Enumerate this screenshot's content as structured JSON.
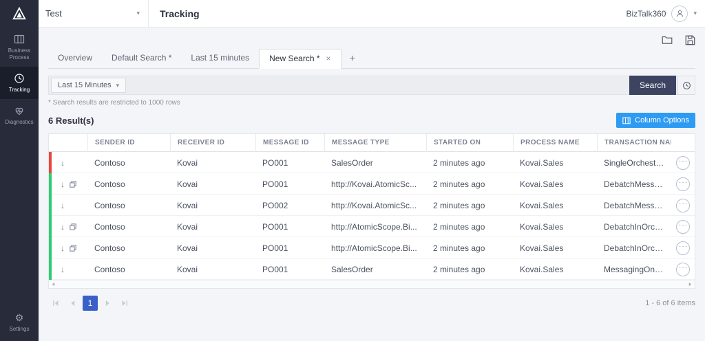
{
  "colors": {
    "sidebar_bg": "#272b3a",
    "accent_blue": "#2e9bf3",
    "search_button": "#3c4461",
    "pager_active": "#3a5fc8",
    "status_red": "#e9473d",
    "status_green": "#2dcc70"
  },
  "icons": {
    "caret": "▾",
    "download": "↓",
    "more": "···",
    "gear": "⚙"
  },
  "topbar": {
    "workspace": "Test",
    "title": "Tracking",
    "user_label": "BizTalk360"
  },
  "sidebar": {
    "items": [
      {
        "label": "Business Process"
      },
      {
        "label": "Tracking"
      },
      {
        "label": "Diagnostics"
      }
    ],
    "settings_label": "Settings"
  },
  "toolbar_tabs": {
    "tabs": [
      {
        "label": "Overview"
      },
      {
        "label": "Default Search *"
      },
      {
        "label": "Last 15 minutes"
      },
      {
        "label": "New Search *",
        "active": true
      }
    ],
    "close_label": "×",
    "add_tab_label": "+"
  },
  "filterbar": {
    "time_filter": "Last 15 Minutes",
    "search_label": "Search"
  },
  "restriction_note": "* Search results are restricted to 1000 rows",
  "results": {
    "count": "6 Result(s)",
    "column_options": "Column Options"
  },
  "table": {
    "headers": [
      "SENDER ID",
      "RECEIVER ID",
      "MESSAGE ID",
      "MESSAGE TYPE",
      "STARTED ON",
      "PROCESS NAME",
      "TRANSACTION NAME"
    ],
    "rows": [
      {
        "status_color": "#e9473d",
        "has_batch_icon": false,
        "sender": "Contoso",
        "receiver": "Kovai",
        "message_id": "PO001",
        "message_type": "SalesOrder",
        "started_on": "2 minutes ago",
        "process_name": "Kovai.Sales",
        "transaction_name": "SingleOrchestrationSc..."
      },
      {
        "status_color": "#2dcc70",
        "has_batch_icon": true,
        "sender": "Contoso",
        "receiver": "Kovai",
        "message_id": "PO001",
        "message_type": "http://Kovai.AtomicSc...",
        "started_on": "2 minutes ago",
        "process_name": "Kovai.Sales",
        "transaction_name": "DebatchMessagingOnly"
      },
      {
        "status_color": "#2dcc70",
        "has_batch_icon": false,
        "sender": "Contoso",
        "receiver": "Kovai",
        "message_id": "PO002",
        "message_type": "http://Kovai.AtomicSc...",
        "started_on": "2 minutes ago",
        "process_name": "Kovai.Sales",
        "transaction_name": "DebatchMessagingOnly"
      },
      {
        "status_color": "#2dcc70",
        "has_batch_icon": true,
        "sender": "Contoso",
        "receiver": "Kovai",
        "message_id": "PO001",
        "message_type": "http://AtomicScope.Bi...",
        "started_on": "2 minutes ago",
        "process_name": "Kovai.Sales",
        "transaction_name": "DebatchInOrchestrati..."
      },
      {
        "status_color": "#2dcc70",
        "has_batch_icon": true,
        "sender": "Contoso",
        "receiver": "Kovai",
        "message_id": "PO001",
        "message_type": "http://AtomicScope.Bi...",
        "started_on": "2 minutes ago",
        "process_name": "Kovai.Sales",
        "transaction_name": "DebatchInOrchestrati..."
      },
      {
        "status_color": "#2dcc70",
        "has_batch_icon": false,
        "sender": "Contoso",
        "receiver": "Kovai",
        "message_id": "PO001",
        "message_type": "SalesOrder",
        "started_on": "2 minutes ago",
        "process_name": "Kovai.Sales",
        "transaction_name": "MessagingOnlyScenario"
      }
    ]
  },
  "pagination": {
    "current_page": "1",
    "summary": "1 - 6 of 6 items"
  }
}
